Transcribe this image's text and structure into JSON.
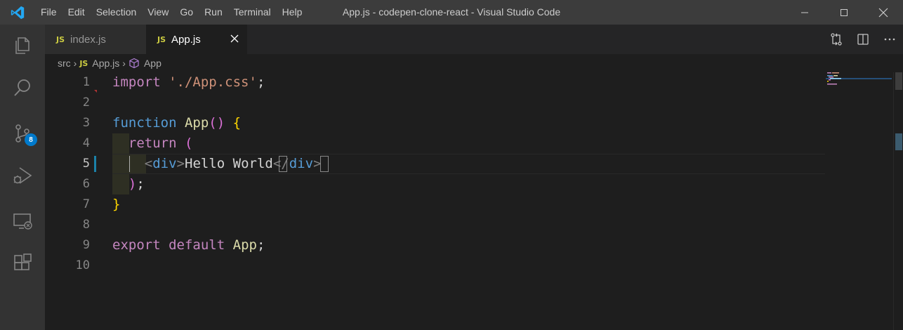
{
  "window": {
    "title": "App.js - codepen-clone-react - Visual Studio Code"
  },
  "menu": [
    "File",
    "Edit",
    "Selection",
    "View",
    "Go",
    "Run",
    "Terminal",
    "Help"
  ],
  "activity_bar": {
    "items": [
      {
        "name": "explorer",
        "icon": "files-icon"
      },
      {
        "name": "search",
        "icon": "search-icon"
      },
      {
        "name": "source-control",
        "icon": "source-control-icon",
        "badge": "8"
      },
      {
        "name": "run-debug",
        "icon": "run-debug-icon"
      },
      {
        "name": "remote-explorer",
        "icon": "remote-explorer-icon"
      },
      {
        "name": "extensions",
        "icon": "extensions-icon"
      }
    ]
  },
  "tabs": [
    {
      "icon_label": "JS",
      "label": "index.js",
      "active": false
    },
    {
      "icon_label": "JS",
      "label": "App.js",
      "active": true
    }
  ],
  "breadcrumbs": {
    "folder": "src",
    "file_icon": "JS",
    "file": "App.js",
    "symbol": "App"
  },
  "editor": {
    "active_line": 5,
    "lines": [
      {
        "no": "1"
      },
      {
        "no": "2"
      },
      {
        "no": "3"
      },
      {
        "no": "4"
      },
      {
        "no": "5"
      },
      {
        "no": "6"
      },
      {
        "no": "7"
      },
      {
        "no": "8"
      },
      {
        "no": "9"
      },
      {
        "no": "10"
      }
    ],
    "tokens": {
      "l1_import": "import",
      "l1_str": "'./App.css'",
      "l1_semi": ";",
      "l3_function": "function",
      "l3_name": "App",
      "l3_parens": "()",
      "l3_brace": "{",
      "l4_return": "return",
      "l4_paren": "(",
      "l5_open_lt": "<",
      "l5_open_tag": "div",
      "l5_open_gt": ">",
      "l5_text": "Hello World",
      "l5_close_lt": "</",
      "l5_close_tag": "div",
      "l5_close_gt": ">",
      "l6_paren": ")",
      "l6_semi": ";",
      "l7_brace": "}",
      "l9_export": "export",
      "l9_default": "default",
      "l9_name": "App",
      "l9_semi": ";"
    }
  },
  "colors": {
    "titlebar": "#3c3c3c",
    "activitybar": "#333333",
    "editor_bg": "#1e1e1e",
    "accent": "#007acc"
  }
}
